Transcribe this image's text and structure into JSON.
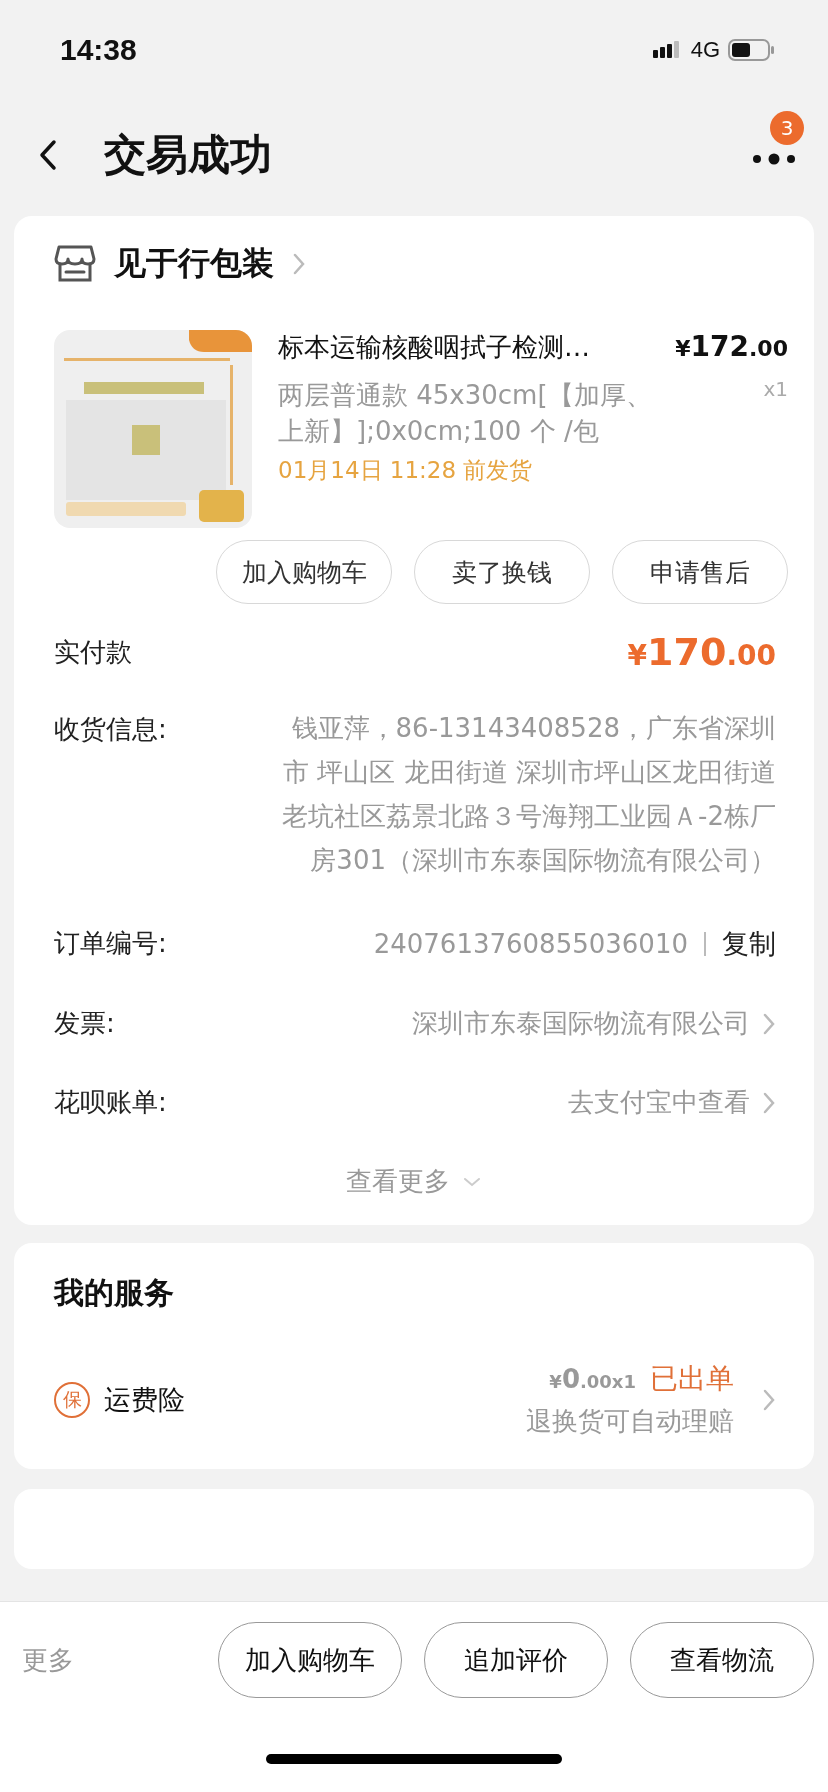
{
  "status_bar": {
    "time": "14:38",
    "network": "4G"
  },
  "header": {
    "title": "交易成功",
    "badge": "3"
  },
  "store": {
    "name": "见于行包装"
  },
  "product": {
    "image": {
      "kind": "picture"
    },
    "title": "标本运输核酸咽拭子检测…",
    "price": {
      "symbol": "¥",
      "integer": "172",
      "decimal": ".00"
    },
    "quantity": "x1",
    "spec": "两层普通款 45x30cm[【加厚、上新】];0x0cm;100 个 /包",
    "shipping": "01月14日 11:28 前发货",
    "actions": [
      "加入购物车",
      "卖了换钱",
      "申请售后"
    ]
  },
  "payment": {
    "label": "实付款",
    "price": {
      "symbol": "¥",
      "integer": "170",
      "decimal": ".00"
    }
  },
  "info_rows": [
    {
      "kind": "address",
      "label": "收货信息:",
      "value": "钱亚萍，86-13143408528，广东省深圳市 坪山区 龙田街道 深圳市坪山区龙田街道老坑社区荔景北路３号海翔工业园Ａ-2栋厂房301（深圳市东泰国际物流有限公司）"
    },
    {
      "kind": "copy",
      "label": "订单编号:",
      "value": "2407613760855036010",
      "action": "复制"
    },
    {
      "kind": "link",
      "label": "发票:",
      "value": "深圳市东泰国际物流有限公司"
    },
    {
      "kind": "link",
      "label": "花呗账单:",
      "value": "去支付宝中查看"
    }
  ],
  "more_link": "查看更多",
  "services": {
    "title": "我的服务",
    "items": [
      {
        "badge": "保",
        "name": "运费险",
        "price": {
          "symbol": "¥",
          "integer": "0",
          "decimal": ".00x1"
        },
        "status": "已出单",
        "note": "退换货可自动理赔"
      }
    ]
  },
  "bottom_bar": {
    "more": "更多",
    "buttons": [
      "加入购物车",
      "追加评价",
      "查看物流"
    ]
  }
}
